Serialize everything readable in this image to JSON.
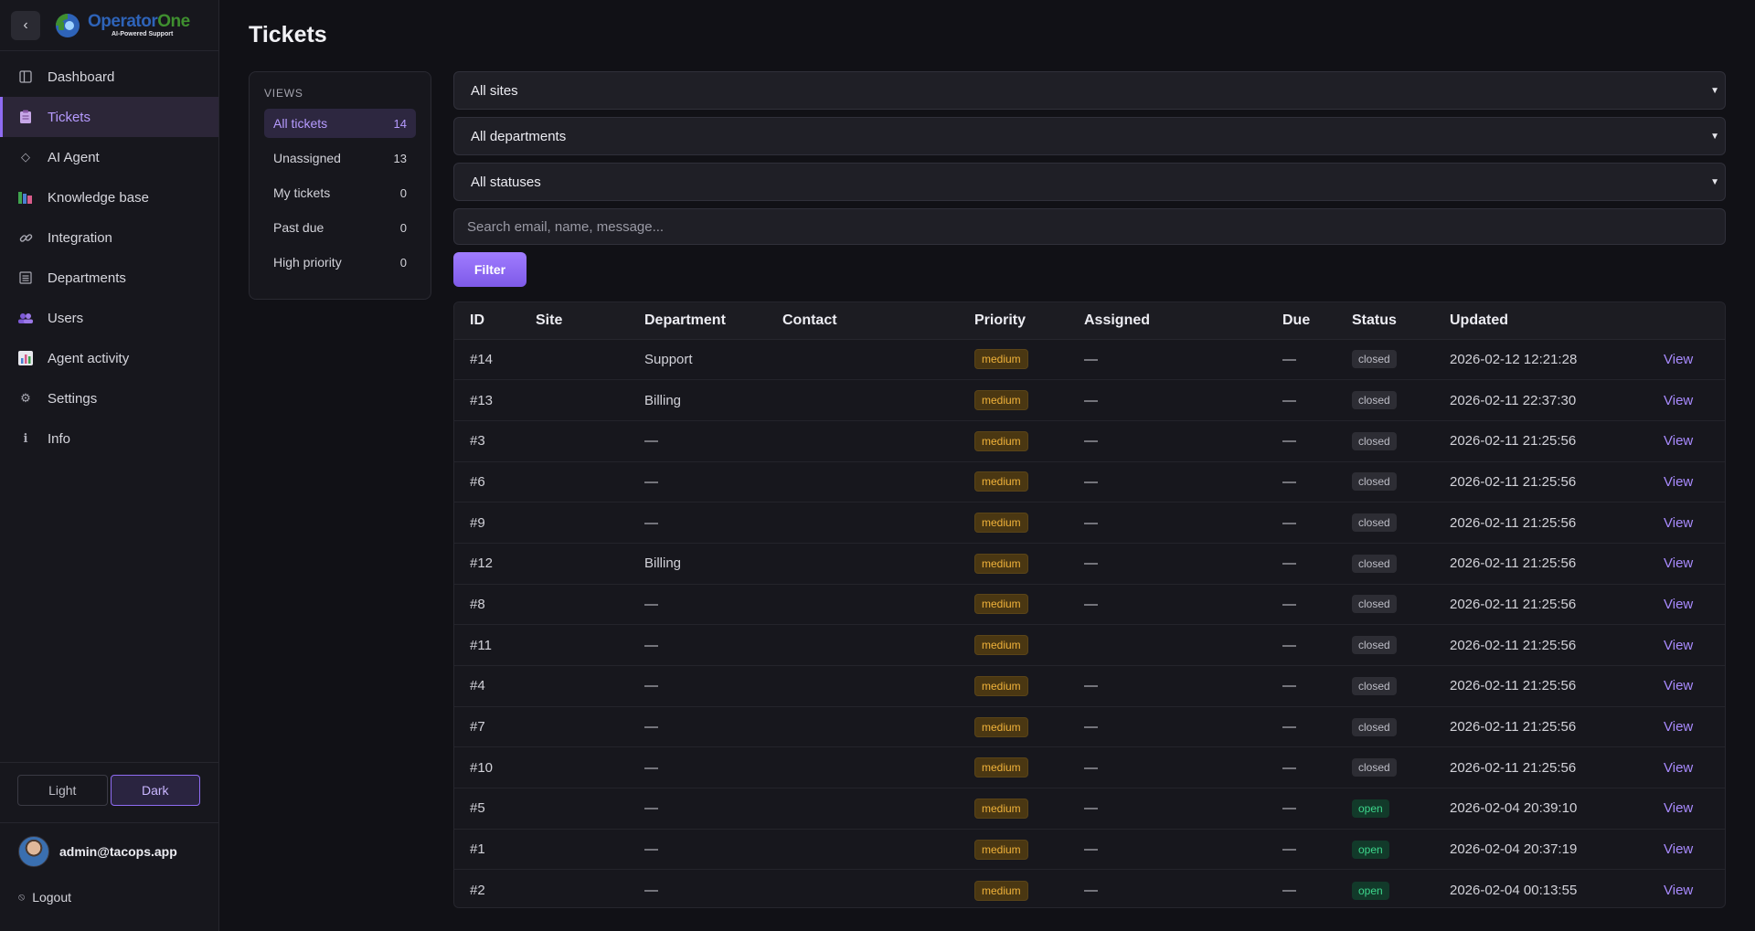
{
  "app": {
    "logo_name_part1": "Operator",
    "logo_name_part2": "One",
    "logo_tagline": "AI-Powered Support"
  },
  "sidebar": {
    "items": [
      {
        "label": "Dashboard",
        "icon": "dashboard-icon"
      },
      {
        "label": "Tickets",
        "icon": "tickets-icon",
        "active": true
      },
      {
        "label": "AI Agent",
        "icon": "diamond-icon"
      },
      {
        "label": "Knowledge base",
        "icon": "books-icon"
      },
      {
        "label": "Integration",
        "icon": "link-icon"
      },
      {
        "label": "Departments",
        "icon": "list-icon"
      },
      {
        "label": "Users",
        "icon": "users-icon"
      },
      {
        "label": "Agent activity",
        "icon": "bar-chart-icon"
      },
      {
        "label": "Settings",
        "icon": "gear-icon"
      },
      {
        "label": "Info",
        "icon": "info-icon"
      }
    ],
    "theme": {
      "light": "Light",
      "dark": "Dark",
      "selected": "Dark"
    },
    "user_email": "admin@tacops.app",
    "logout": "Logout"
  },
  "main": {
    "title": "Tickets",
    "views": {
      "heading": "VIEWS",
      "items": [
        {
          "label": "All tickets",
          "count": "14"
        },
        {
          "label": "Unassigned",
          "count": "13"
        },
        {
          "label": "My tickets",
          "count": "0"
        },
        {
          "label": "Past due",
          "count": "0"
        },
        {
          "label": "High priority",
          "count": "0"
        }
      ]
    },
    "filters": {
      "site": "All sites",
      "department": "All departments",
      "status": "All statuses",
      "search_placeholder": "Search email, name, message...",
      "filter_button": "Filter"
    },
    "table": {
      "columns": [
        "ID",
        "Site",
        "Department",
        "Contact",
        "Priority",
        "Assigned",
        "Due",
        "Status",
        "Updated",
        ""
      ],
      "rows": [
        {
          "id": "#14",
          "site": "",
          "department": "Support",
          "contact": "",
          "priority": "medium",
          "assigned": "—",
          "due": "—",
          "status": "closed",
          "updated": "2026-02-12 12:21:28",
          "action": "View"
        },
        {
          "id": "#13",
          "site": "",
          "department": "Billing",
          "contact": "",
          "priority": "medium",
          "assigned": "—",
          "due": "—",
          "status": "closed",
          "updated": "2026-02-11 22:37:30",
          "action": "View"
        },
        {
          "id": "#3",
          "site": "",
          "department": "—",
          "contact": "",
          "priority": "medium",
          "assigned": "—",
          "due": "—",
          "status": "closed",
          "updated": "2026-02-11 21:25:56",
          "action": "View"
        },
        {
          "id": "#6",
          "site": "",
          "department": "—",
          "contact": "",
          "priority": "medium",
          "assigned": "—",
          "due": "—",
          "status": "closed",
          "updated": "2026-02-11 21:25:56",
          "action": "View"
        },
        {
          "id": "#9",
          "site": "",
          "department": "—",
          "contact": "",
          "priority": "medium",
          "assigned": "—",
          "due": "—",
          "status": "closed",
          "updated": "2026-02-11 21:25:56",
          "action": "View"
        },
        {
          "id": "#12",
          "site": "",
          "department": "Billing",
          "contact": "",
          "priority": "medium",
          "assigned": "—",
          "due": "—",
          "status": "closed",
          "updated": "2026-02-11 21:25:56",
          "action": "View"
        },
        {
          "id": "#8",
          "site": "",
          "department": "—",
          "contact": "",
          "priority": "medium",
          "assigned": "—",
          "due": "—",
          "status": "closed",
          "updated": "2026-02-11 21:25:56",
          "action": "View"
        },
        {
          "id": "#11",
          "site": "",
          "department": "—",
          "contact": "",
          "priority": "medium",
          "assigned": "",
          "due": "—",
          "status": "closed",
          "updated": "2026-02-11 21:25:56",
          "action": "View"
        },
        {
          "id": "#4",
          "site": "",
          "department": "—",
          "contact": "",
          "priority": "medium",
          "assigned": "—",
          "due": "—",
          "status": "closed",
          "updated": "2026-02-11 21:25:56",
          "action": "View"
        },
        {
          "id": "#7",
          "site": "",
          "department": "—",
          "contact": "",
          "priority": "medium",
          "assigned": "—",
          "due": "—",
          "status": "closed",
          "updated": "2026-02-11 21:25:56",
          "action": "View"
        },
        {
          "id": "#10",
          "site": "",
          "department": "—",
          "contact": "",
          "priority": "medium",
          "assigned": "—",
          "due": "—",
          "status": "closed",
          "updated": "2026-02-11 21:25:56",
          "action": "View"
        },
        {
          "id": "#5",
          "site": "",
          "department": "—",
          "contact": "",
          "priority": "medium",
          "assigned": "—",
          "due": "—",
          "status": "open",
          "updated": "2026-02-04 20:39:10",
          "action": "View"
        },
        {
          "id": "#1",
          "site": "",
          "department": "—",
          "contact": "",
          "priority": "medium",
          "assigned": "—",
          "due": "—",
          "status": "open",
          "updated": "2026-02-04 20:37:19",
          "action": "View"
        },
        {
          "id": "#2",
          "site": "",
          "department": "—",
          "contact": "",
          "priority": "medium",
          "assigned": "—",
          "due": "—",
          "status": "open",
          "updated": "2026-02-04 00:13:55",
          "action": "View"
        }
      ]
    }
  },
  "colors": {
    "accent": "#8f6cf3",
    "priority_medium": "#f0b23a",
    "status_open": "#3dd68c",
    "background": "#111116"
  }
}
